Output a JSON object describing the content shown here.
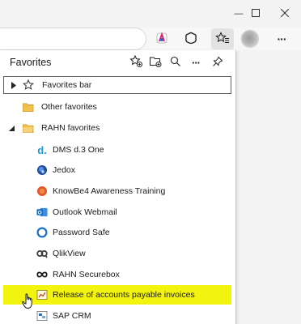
{
  "window": {
    "minimize_glyph": "—",
    "maximize_glyph": "☐",
    "close_glyph": "✕"
  },
  "toolbar": {
    "buttons": [
      "extension-icon",
      "copilot-icon",
      "favorites-icon",
      "profile-avatar",
      "more-icon"
    ],
    "more_glyph": "···"
  },
  "favorites": {
    "title": "Favorites",
    "header_buttons": [
      "add-favorite-icon",
      "add-folder-icon",
      "search-icon",
      "more-options-icon",
      "pin-icon"
    ],
    "more_glyph": "···",
    "items": [
      {
        "label": "Favorites bar",
        "icon": "star-icon",
        "type": "folder",
        "expanded": false
      },
      {
        "label": "Other favorites",
        "icon": "folder-icon",
        "type": "folder"
      },
      {
        "label": "RAHN favorites",
        "icon": "folder-icon",
        "type": "folder",
        "expanded": true
      },
      {
        "label": "DMS d.3 One",
        "icon": "d3-logo-icon",
        "glyph": "d."
      },
      {
        "label": "Jedox",
        "icon": "jedox-logo-icon"
      },
      {
        "label": "KnowBe4 Awareness Training",
        "icon": "knowbe4-logo-icon"
      },
      {
        "label": "Outlook Webmail",
        "icon": "outlook-logo-icon",
        "glyph": "O"
      },
      {
        "label": "Password Safe",
        "icon": "password-safe-icon"
      },
      {
        "label": "QlikView",
        "icon": "qlikview-logo-icon"
      },
      {
        "label": "RAHN Securebox",
        "icon": "securebox-logo-icon"
      },
      {
        "label": "Release of accounts payable invoices",
        "icon": "chart-doc-icon",
        "highlighted": true
      },
      {
        "label": "SAP CRM",
        "icon": "sap-crm-icon"
      }
    ]
  },
  "colors": {
    "highlight": "#f3f310",
    "accent_blue": "#0f6cbd",
    "folder_yellow": "#f2c14e"
  }
}
